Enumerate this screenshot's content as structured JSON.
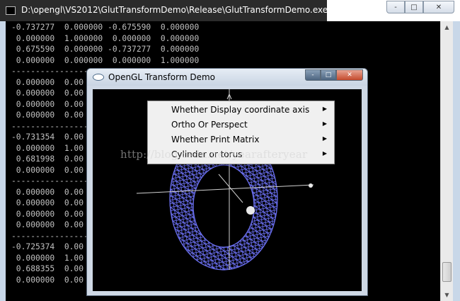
{
  "console": {
    "title": "D:\\opengl\\VS2012\\GlutTransformDemo\\Release\\GlutTransformDemo.exe",
    "lines": [
      "-0.737277  0.000000 -0.675590  0.000000",
      " 0.000000  1.000000  0.000000  0.000000",
      " 0.675590  0.000000 -0.737277  0.000000",
      " 0.000000  0.000000  0.000000  1.000000",
      "------------------",
      " 0.000000  0.00",
      " 0.000000  0.00",
      " 0.000000  0.00",
      " 0.000000  0.00",
      "------------------",
      "-0.731354  0.00",
      " 0.000000  1.00",
      " 0.681998  0.00",
      " 0.000000  0.00",
      "------------------",
      " 0.000000  0.00",
      " 0.000000  0.00",
      " 0.000000  0.00",
      " 0.000000  0.00",
      "------------------",
      "-0.725374  0.00",
      " 0.000000  1.00",
      " 0.688355  0.00",
      " 0.000000  0.00"
    ],
    "controls": {
      "minimize": "-",
      "maximize": "□",
      "close": "✕"
    }
  },
  "gl_window": {
    "title": "OpenGL Transform Demo",
    "controls": {
      "minimize": "-",
      "maximize": "□",
      "close": "✕"
    }
  },
  "context_menu": {
    "items": [
      {
        "label": "Whether Display coordinate axis",
        "has_submenu": true
      },
      {
        "label": "Ortho Or Perspect",
        "has_submenu": true
      },
      {
        "label": "Whether Print Matrix",
        "has_submenu": true
      },
      {
        "label": "Cylinder or torus",
        "has_submenu": true
      }
    ],
    "submenu_arrow": "▶"
  },
  "watermark": "http://blog.csdn.net/yearafteryear",
  "scene": {
    "torus_color": "#6a6ff0",
    "axis_color": "#d0d0d0",
    "sphere_color": "#e8e8e8"
  },
  "icons": [
    "console-app-icon",
    "opengl-app-icon",
    "scroll-up-icon",
    "scroll-down-icon",
    "submenu-arrow-icon"
  ]
}
